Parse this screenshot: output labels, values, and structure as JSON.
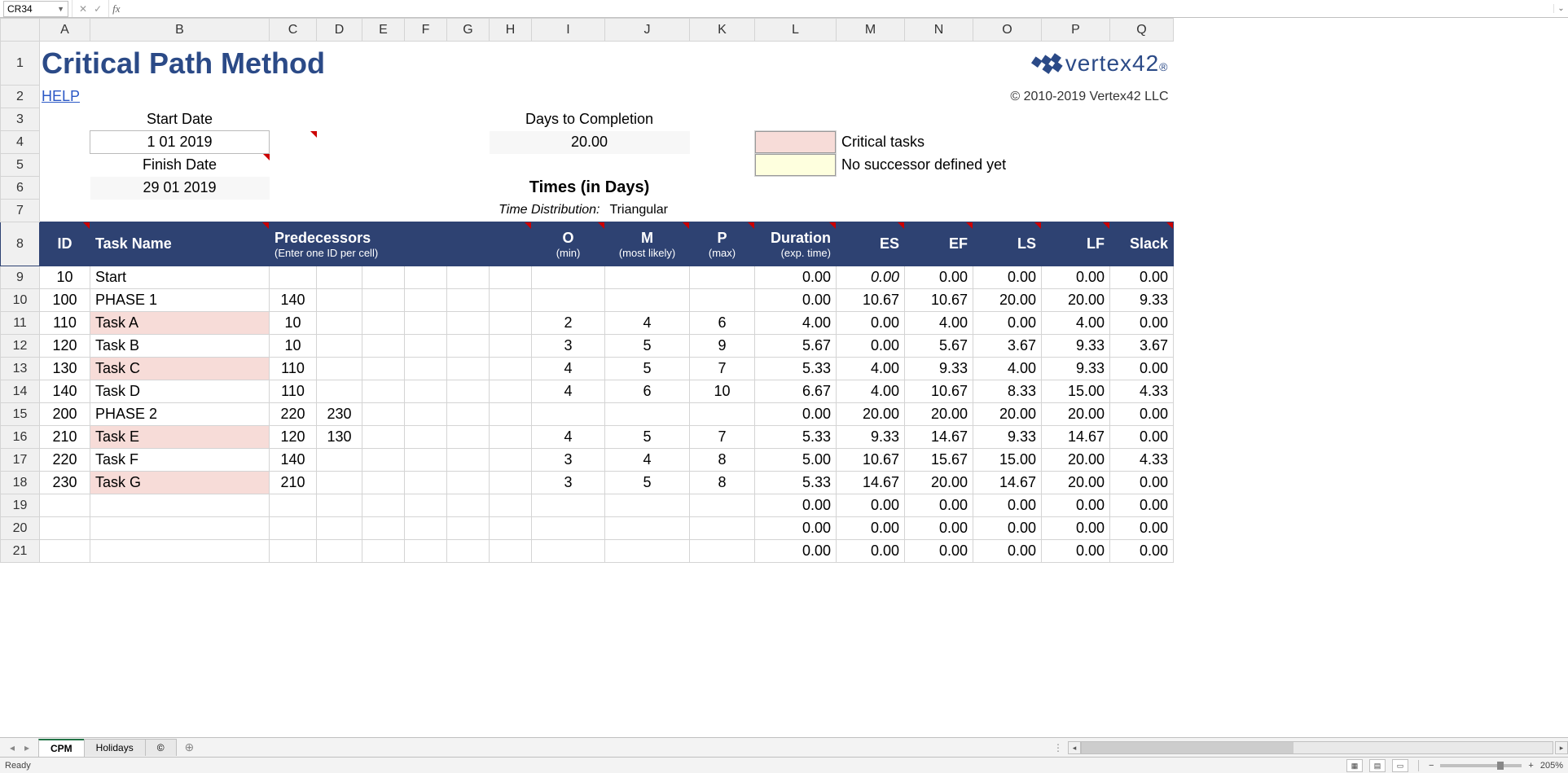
{
  "formula_bar": {
    "name_box": "CR34",
    "formula": ""
  },
  "columns": [
    "A",
    "B",
    "C",
    "D",
    "E",
    "F",
    "G",
    "H",
    "I",
    "J",
    "K",
    "L",
    "M",
    "N",
    "O",
    "P",
    "Q"
  ],
  "row_numbers": [
    1,
    2,
    3,
    4,
    5,
    6,
    7,
    8,
    9,
    10,
    11,
    12,
    13,
    14,
    15,
    16,
    17,
    18,
    19,
    20,
    21
  ],
  "title": "Critical Path Method",
  "help": "HELP",
  "logo": "vertex42",
  "copyright": "© 2010-2019 Vertex42 LLC",
  "labels": {
    "start_date": "Start Date",
    "start_date_val": "1 01 2019",
    "finish_date": "Finish Date",
    "finish_date_val": "29 01 2019",
    "days_to_completion": "Days to Completion",
    "days_val": "20.00",
    "times_in_days": "Times (in Days)",
    "time_dist_lbl": "Time Distribution:",
    "time_dist_val": "Triangular",
    "critical_tasks": "Critical tasks",
    "no_successor": "No successor defined yet"
  },
  "headers": {
    "id": "ID",
    "task_name": "Task Name",
    "predecessors": "Predecessors",
    "predecessors_sub": "(Enter one ID per cell)",
    "o": "O",
    "o_sub": "(min)",
    "m": "M",
    "m_sub": "(most likely)",
    "p": "P",
    "p_sub": "(max)",
    "duration": "Duration",
    "duration_sub": "(exp. time)",
    "es": "ES",
    "ef": "EF",
    "ls": "LS",
    "lf": "LF",
    "slack": "Slack"
  },
  "rows": [
    {
      "r": 9,
      "id": "10",
      "name": "Start",
      "pred": [
        "",
        "",
        "",
        "",
        "",
        ""
      ],
      "o": "",
      "m": "",
      "p": "",
      "dur": "0.00",
      "es": "0.00",
      "ef": "0.00",
      "ls": "0.00",
      "lf": "0.00",
      "slack": "0.00",
      "crit": false,
      "italic_es": true
    },
    {
      "r": 10,
      "id": "100",
      "name": "PHASE 1",
      "pred": [
        "140",
        "",
        "",
        "",
        "",
        ""
      ],
      "o": "",
      "m": "",
      "p": "",
      "dur": "0.00",
      "es": "10.67",
      "ef": "10.67",
      "ls": "20.00",
      "lf": "20.00",
      "slack": "9.33",
      "crit": false
    },
    {
      "r": 11,
      "id": "110",
      "name": "Task A",
      "pred": [
        "10",
        "",
        "",
        "",
        "",
        ""
      ],
      "o": "2",
      "m": "4",
      "p": "6",
      "dur": "4.00",
      "es": "0.00",
      "ef": "4.00",
      "ls": "0.00",
      "lf": "4.00",
      "slack": "0.00",
      "crit": true
    },
    {
      "r": 12,
      "id": "120",
      "name": "Task B",
      "pred": [
        "10",
        "",
        "",
        "",
        "",
        ""
      ],
      "o": "3",
      "m": "5",
      "p": "9",
      "dur": "5.67",
      "es": "0.00",
      "ef": "5.67",
      "ls": "3.67",
      "lf": "9.33",
      "slack": "3.67",
      "crit": false
    },
    {
      "r": 13,
      "id": "130",
      "name": "Task C",
      "pred": [
        "110",
        "",
        "",
        "",
        "",
        ""
      ],
      "o": "4",
      "m": "5",
      "p": "7",
      "dur": "5.33",
      "es": "4.00",
      "ef": "9.33",
      "ls": "4.00",
      "lf": "9.33",
      "slack": "0.00",
      "crit": true
    },
    {
      "r": 14,
      "id": "140",
      "name": "Task D",
      "pred": [
        "110",
        "",
        "",
        "",
        "",
        ""
      ],
      "o": "4",
      "m": "6",
      "p": "10",
      "dur": "6.67",
      "es": "4.00",
      "ef": "10.67",
      "ls": "8.33",
      "lf": "15.00",
      "slack": "4.33",
      "crit": false
    },
    {
      "r": 15,
      "id": "200",
      "name": "PHASE 2",
      "pred": [
        "220",
        "230",
        "",
        "",
        "",
        ""
      ],
      "o": "",
      "m": "",
      "p": "",
      "dur": "0.00",
      "es": "20.00",
      "ef": "20.00",
      "ls": "20.00",
      "lf": "20.00",
      "slack": "0.00",
      "crit": false
    },
    {
      "r": 16,
      "id": "210",
      "name": "Task E",
      "pred": [
        "120",
        "130",
        "",
        "",
        "",
        ""
      ],
      "o": "4",
      "m": "5",
      "p": "7",
      "dur": "5.33",
      "es": "9.33",
      "ef": "14.67",
      "ls": "9.33",
      "lf": "14.67",
      "slack": "0.00",
      "crit": true
    },
    {
      "r": 17,
      "id": "220",
      "name": "Task F",
      "pred": [
        "140",
        "",
        "",
        "",
        "",
        ""
      ],
      "o": "3",
      "m": "4",
      "p": "8",
      "dur": "5.00",
      "es": "10.67",
      "ef": "15.67",
      "ls": "15.00",
      "lf": "20.00",
      "slack": "4.33",
      "crit": false
    },
    {
      "r": 18,
      "id": "230",
      "name": "Task G",
      "pred": [
        "210",
        "",
        "",
        "",
        "",
        ""
      ],
      "o": "3",
      "m": "5",
      "p": "8",
      "dur": "5.33",
      "es": "14.67",
      "ef": "20.00",
      "ls": "14.67",
      "lf": "20.00",
      "slack": "0.00",
      "crit": true
    },
    {
      "r": 19,
      "id": "",
      "name": "",
      "pred": [
        "",
        "",
        "",
        "",
        "",
        ""
      ],
      "o": "",
      "m": "",
      "p": "",
      "dur": "0.00",
      "es": "0.00",
      "ef": "0.00",
      "ls": "0.00",
      "lf": "0.00",
      "slack": "0.00",
      "crit": false
    },
    {
      "r": 20,
      "id": "",
      "name": "",
      "pred": [
        "",
        "",
        "",
        "",
        "",
        ""
      ],
      "o": "",
      "m": "",
      "p": "",
      "dur": "0.00",
      "es": "0.00",
      "ef": "0.00",
      "ls": "0.00",
      "lf": "0.00",
      "slack": "0.00",
      "crit": false
    },
    {
      "r": 21,
      "id": "",
      "name": "",
      "pred": [
        "",
        "",
        "",
        "",
        "",
        ""
      ],
      "o": "",
      "m": "",
      "p": "",
      "dur": "0.00",
      "es": "0.00",
      "ef": "0.00",
      "ls": "0.00",
      "lf": "0.00",
      "slack": "0.00",
      "crit": false
    }
  ],
  "tabs": {
    "items": [
      "CPM",
      "Holidays",
      "©"
    ],
    "active": 0,
    "add": "⊕"
  },
  "status": {
    "ready": "Ready",
    "zoom": "205%"
  }
}
